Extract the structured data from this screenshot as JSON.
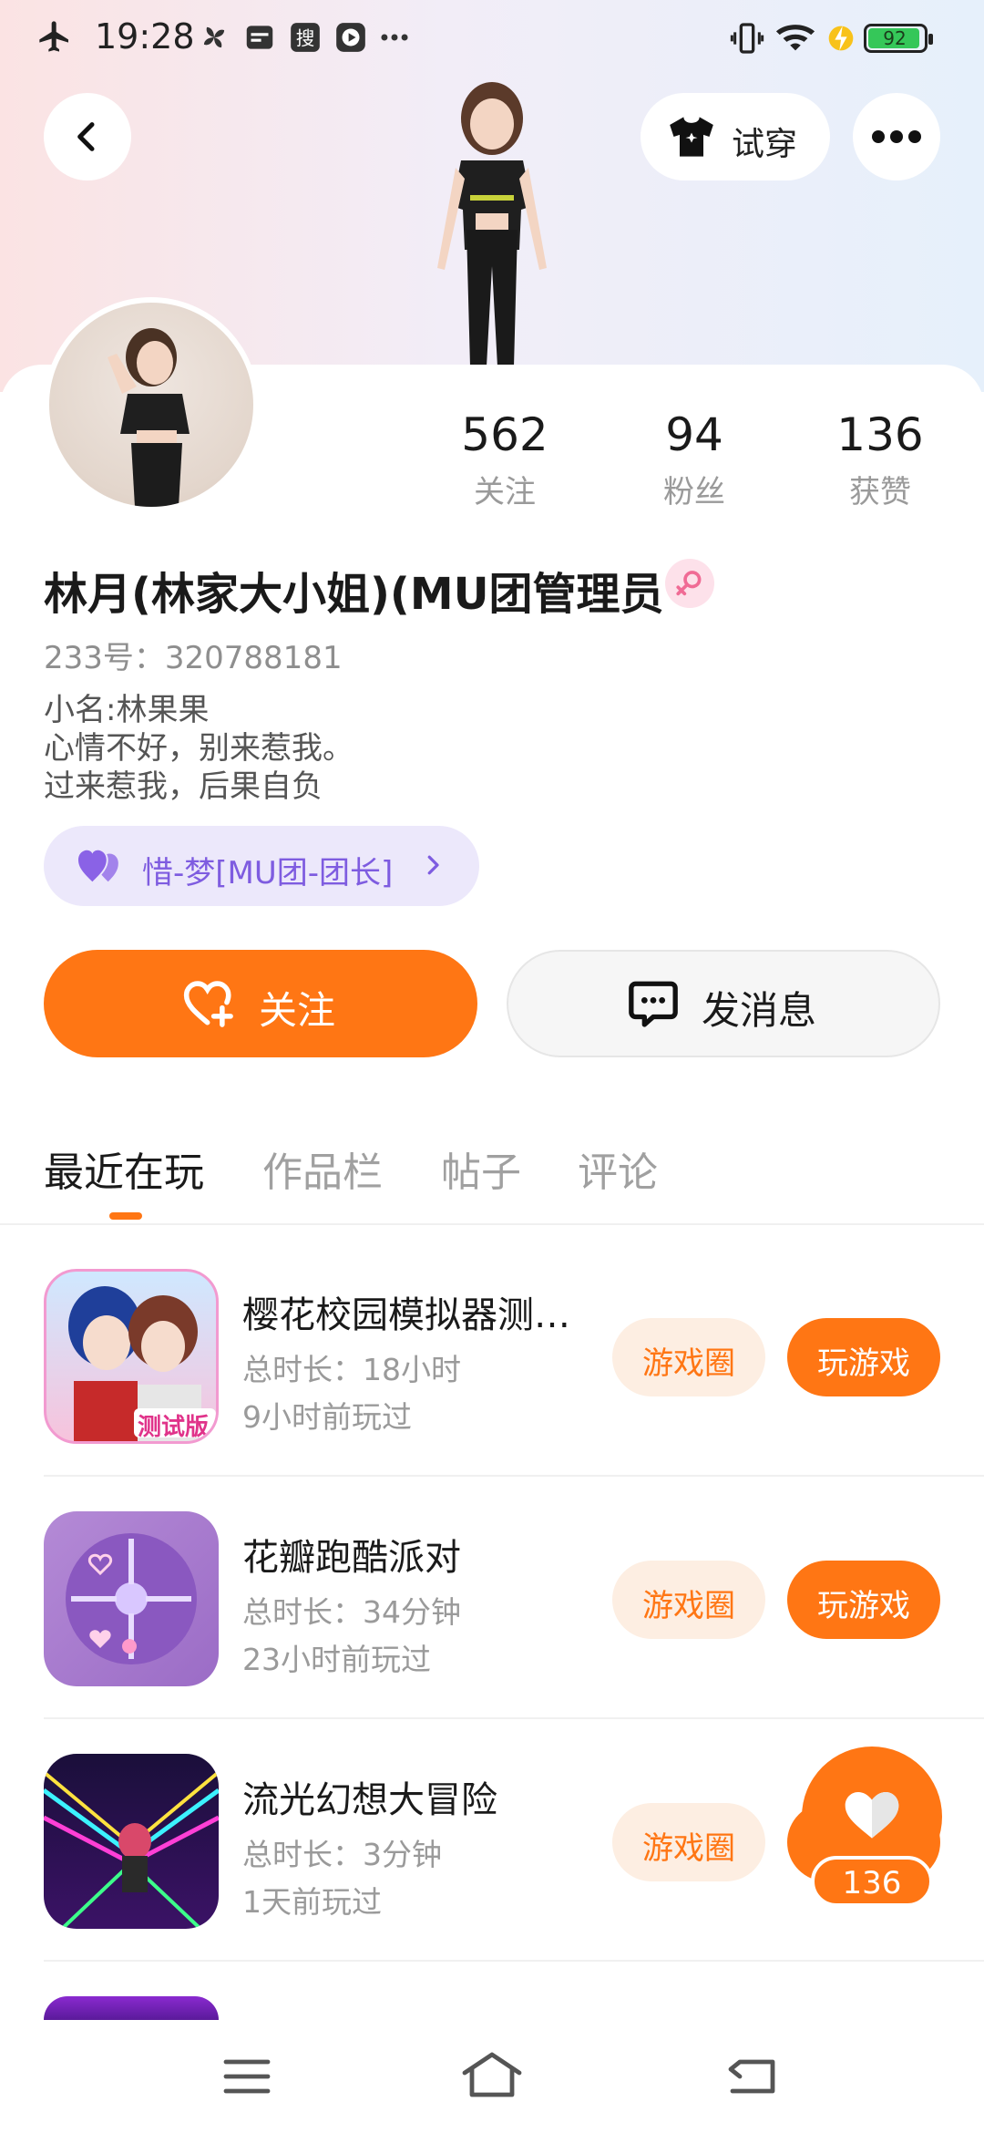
{
  "status_bar": {
    "time": "19:28",
    "battery": "92",
    "icons": [
      "airplane-icon",
      "pinwheel-icon",
      "card-icon",
      "search-app-icon",
      "video-icon",
      "more-dots-icon",
      "vibrate-icon",
      "wifi-icon",
      "charging-icon",
      "battery-icon"
    ]
  },
  "header": {
    "try_on_label": "试穿"
  },
  "profile": {
    "stats": [
      {
        "value": "562",
        "label": "关注"
      },
      {
        "value": "94",
        "label": "粉丝"
      },
      {
        "value": "136",
        "label": "获赞"
      }
    ],
    "name": "林月(林家大小姐)(MU团管理员",
    "uid": "233号：320788181",
    "bio": [
      "小名:林果果",
      "心情不好，别来惹我。",
      "过来惹我，后果自负"
    ],
    "group": "惜-梦[MU团-团长]",
    "follow_label": "关注",
    "message_label": "发消息"
  },
  "tabs": [
    "最近在玩",
    "作品栏",
    "帖子",
    "评论"
  ],
  "games": [
    {
      "title": "樱花校园模拟器测…",
      "duration": "总时长：18小时",
      "last_played": "9小时前玩过",
      "circle_label": "游戏圈",
      "play_label": "玩游戏",
      "icon_badge": "测试版"
    },
    {
      "title": "花瓣跑酷派对",
      "duration": "总时长：34分钟",
      "last_played": "23小时前玩过",
      "circle_label": "游戏圈",
      "play_label": "玩游戏"
    },
    {
      "title": "流光幻想大冒险",
      "duration": "总时长：3分钟",
      "last_played": "1天前玩过",
      "circle_label": "游戏圈",
      "play_label": "玩游戏"
    }
  ],
  "like_fab": {
    "count": "136"
  },
  "colors": {
    "accent": "#ff7614",
    "group_purple": "#7e5ce0",
    "muted": "#9a9a9a"
  }
}
